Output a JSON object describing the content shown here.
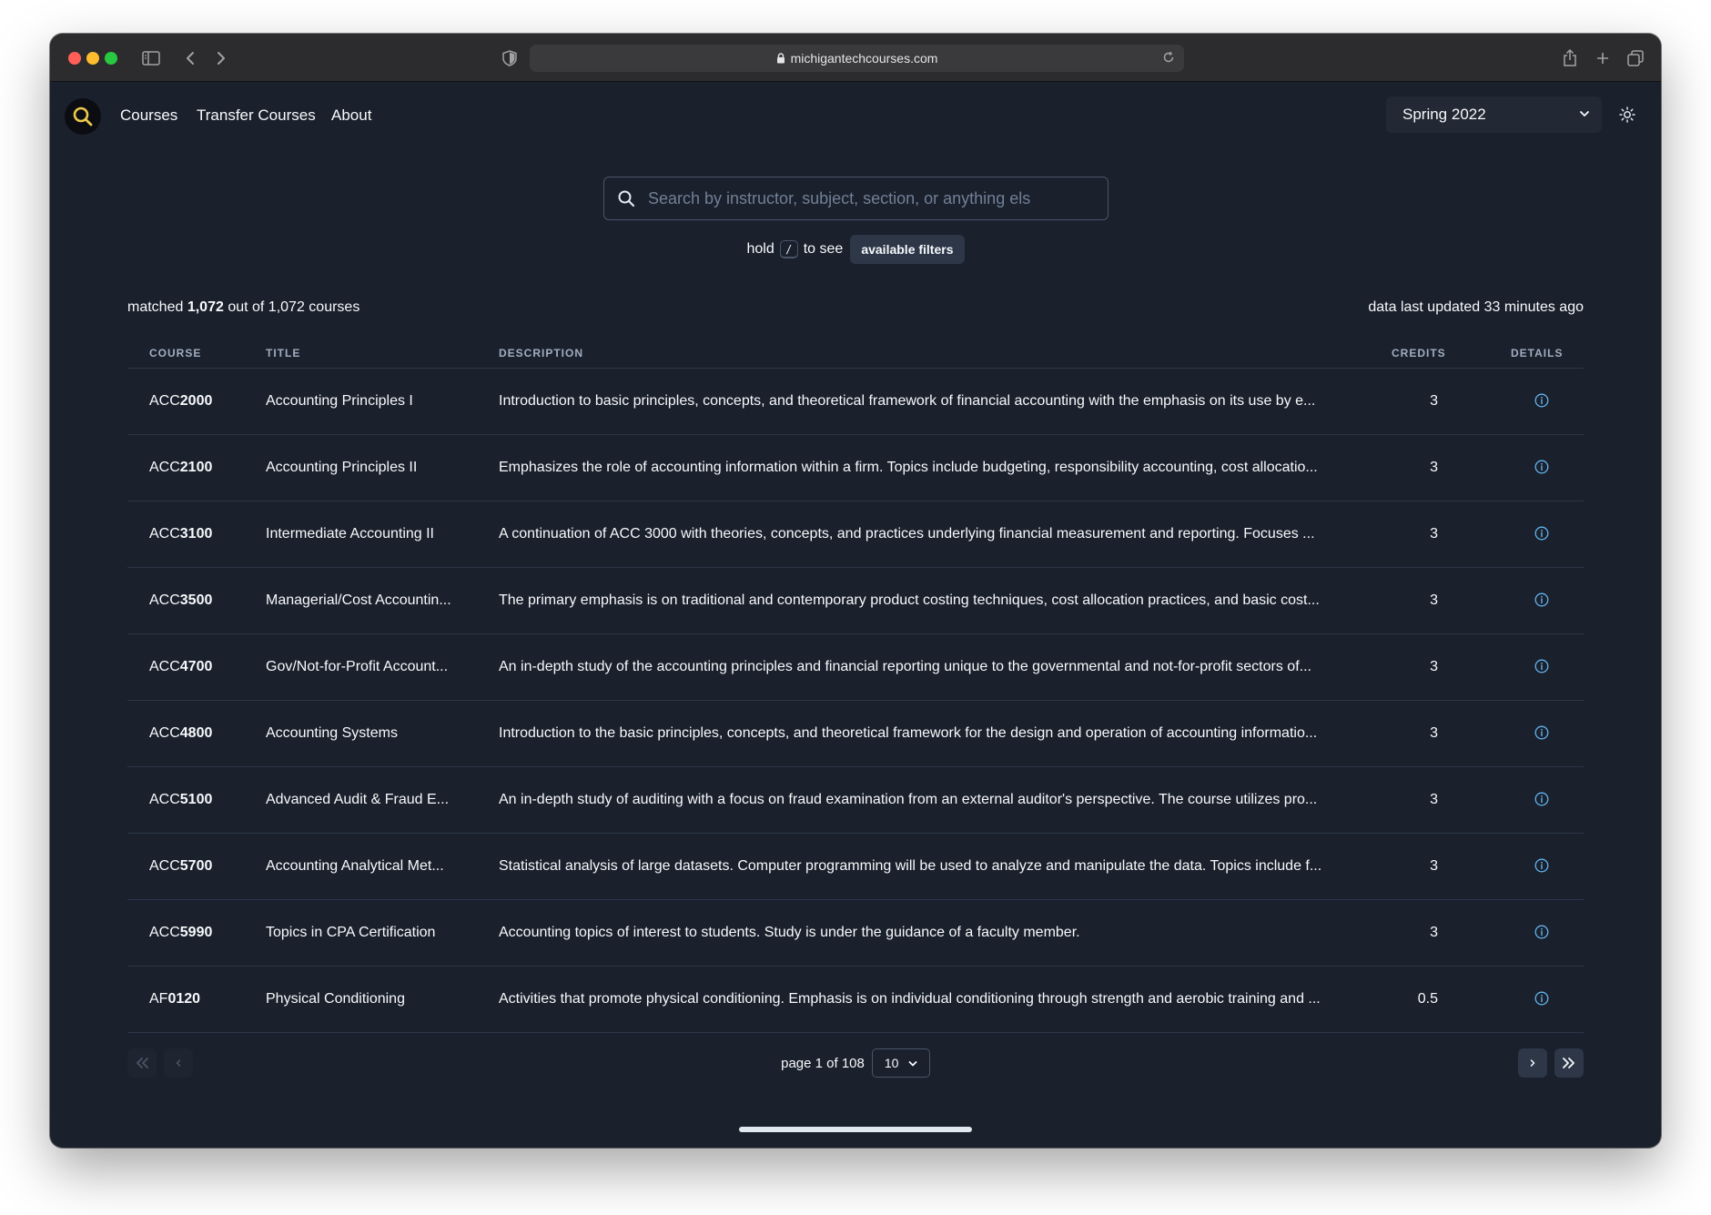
{
  "browser": {
    "url": "michigantechcourses.com"
  },
  "nav": {
    "links": [
      "Courses",
      "Transfer Courses",
      "About"
    ],
    "semester": "Spring 2022"
  },
  "search": {
    "placeholder": "Search by instructor, subject, section, or anything els",
    "value": ""
  },
  "hint": {
    "prefix": "hold",
    "key": "/",
    "suffix": "to see",
    "button": "available filters"
  },
  "summary": {
    "prefix": "matched",
    "matched": "1,072",
    "suffix": "out of 1,072 courses",
    "updated": "data last updated 33 minutes ago"
  },
  "table": {
    "headers": [
      "COURSE",
      "TITLE",
      "DESCRIPTION",
      "CREDITS",
      "DETAILS"
    ],
    "rows": [
      {
        "subject": "ACC",
        "number": "2000",
        "title": "Accounting Principles I",
        "description": "Introduction to basic principles, concepts, and theoretical framework of financial accounting with the emphasis on its use by e...",
        "credits": "3"
      },
      {
        "subject": "ACC",
        "number": "2100",
        "title": "Accounting Principles II",
        "description": "Emphasizes the role of accounting information within a firm. Topics include budgeting, responsibility accounting, cost allocatio...",
        "credits": "3"
      },
      {
        "subject": "ACC",
        "number": "3100",
        "title": "Intermediate Accounting II",
        "description": "A continuation of ACC 3000 with theories, concepts, and practices underlying financial measurement and reporting. Focuses ...",
        "credits": "3"
      },
      {
        "subject": "ACC",
        "number": "3500",
        "title": "Managerial/Cost Accountin...",
        "description": "The primary emphasis is on traditional and contemporary product costing techniques, cost allocation practices, and basic cost...",
        "credits": "3"
      },
      {
        "subject": "ACC",
        "number": "4700",
        "title": "Gov/Not-for-Profit Account...",
        "description": "An in-depth study of the accounting principles and financial reporting unique to the governmental and not-for-profit sectors of...",
        "credits": "3"
      },
      {
        "subject": "ACC",
        "number": "4800",
        "title": "Accounting Systems",
        "description": "Introduction to the basic principles, concepts, and theoretical framework for the design and operation of accounting informatio...",
        "credits": "3"
      },
      {
        "subject": "ACC",
        "number": "5100",
        "title": "Advanced Audit & Fraud E...",
        "description": "An in-depth study of auditing with a focus on fraud examination from an external auditor's perspective. The course utilizes pro...",
        "credits": "3"
      },
      {
        "subject": "ACC",
        "number": "5700",
        "title": "Accounting Analytical Met...",
        "description": "Statistical analysis of large datasets. Computer programming will be used to analyze and manipulate the data. Topics include f...",
        "credits": "3"
      },
      {
        "subject": "ACC",
        "number": "5990",
        "title": "Topics in CPA Certification",
        "description": "Accounting topics of interest to students. Study is under the guidance of a faculty member.",
        "credits": "3"
      },
      {
        "subject": "AF",
        "number": "0120",
        "title": "Physical Conditioning",
        "description": "Activities that promote physical conditioning. Emphasis is on individual conditioning through strength and aerobic training and ...",
        "credits": "0.5"
      }
    ]
  },
  "pagination": {
    "label": "page 1 of 108",
    "page_size": "10"
  },
  "icons": {
    "logo": "search-icon",
    "details": "info-icon",
    "theme": "sun-icon"
  },
  "colors": {
    "background": "#1a202c",
    "accent": "#ecc94b",
    "info": "#63b3ed"
  }
}
